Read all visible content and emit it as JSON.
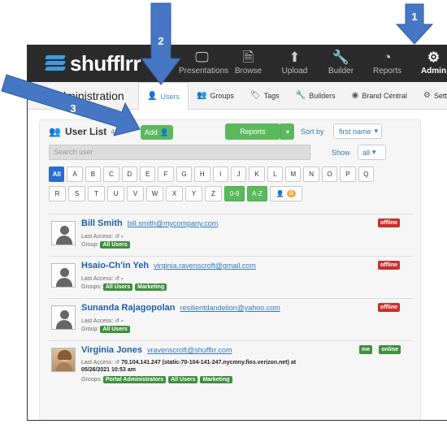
{
  "app": {
    "logo_text": "shufflrr",
    "nav": [
      {
        "label": "Presentations",
        "icon": "monitor-icon"
      },
      {
        "label": "Browse",
        "icon": "document-icon"
      },
      {
        "label": "Upload",
        "icon": "upload-icon"
      },
      {
        "label": "Builder",
        "icon": "wrench-icon"
      },
      {
        "label": "Reports",
        "icon": "pie-chart-icon"
      },
      {
        "label": "Admin",
        "icon": "gear-icon",
        "active": true
      }
    ]
  },
  "subnav": {
    "title": "Administration",
    "tabs": [
      {
        "label": "Users",
        "icon": "user-icon",
        "active": true
      },
      {
        "label": "Groups",
        "icon": "groups-icon"
      },
      {
        "label": "Tags",
        "icon": "tag-icon"
      },
      {
        "label": "Builders",
        "icon": "wrench-icon"
      },
      {
        "label": "Brand Central",
        "icon": "palette-icon"
      },
      {
        "label": "Settin",
        "icon": "settings-icon"
      }
    ]
  },
  "userlist": {
    "title": "User List",
    "count": "4 o",
    "add_label": "Add",
    "reports_label": "Reports",
    "sort_label": "Sort by",
    "sort_value": "first name",
    "search_placeholder": "Search user",
    "show_label": "Show",
    "show_value": "all",
    "letters_row1": [
      "All",
      "A",
      "B",
      "C",
      "D",
      "E",
      "F",
      "G",
      "H",
      "I",
      "J",
      "K",
      "L",
      "M",
      "N",
      "O",
      "P",
      "Q"
    ],
    "letters_row2": [
      "R",
      "S",
      "T",
      "U",
      "V",
      "W",
      "X",
      "Y",
      "Z"
    ],
    "range_09": "0-9",
    "range_az": "A-Z",
    "pending_count": "0"
  },
  "users": [
    {
      "name": "Bill Smith",
      "email": "bill.smith@mycompany.com",
      "last_access_label": "Last Access:",
      "last_access": "-",
      "groups_label": "Group:",
      "groups": [
        "All Users"
      ],
      "status": "offline"
    },
    {
      "name": "Hsaio-Ch'in Yeh",
      "email": "virginia.ravenscroft@gmail.com",
      "last_access_label": "Last Access:",
      "last_access": "-",
      "groups_label": "Groups:",
      "groups": [
        "All Users",
        "Marketing"
      ],
      "status": "offline"
    },
    {
      "name": "Sunanda Rajagopolan",
      "email": "resilientdandelion@yahoo.com",
      "last_access_label": "Last Access:",
      "last_access": "-",
      "groups_label": "Group:",
      "groups": [
        "All Users"
      ],
      "status": "offline"
    },
    {
      "name": "Virginia Jones",
      "email": "vravenscroft@shufflrr.com",
      "last_access_label": "Last Access:",
      "last_access": "70.104.141.247 (static-70-104-141-247.nycmny.fios.verizon.net) at",
      "last_access_date": "05/26/2021 10:53 am",
      "groups_label": "Groups:",
      "groups": [
        "Portal Administrators",
        "All Users",
        "Marketing"
      ],
      "status": "online",
      "me_badge": "me"
    }
  ],
  "annotations": [
    "1",
    "2",
    "3"
  ],
  "colors": {
    "accent": "#337ab7",
    "green": "#5cb85c",
    "arrow": "#4677c4",
    "offline": "#c9302c"
  }
}
